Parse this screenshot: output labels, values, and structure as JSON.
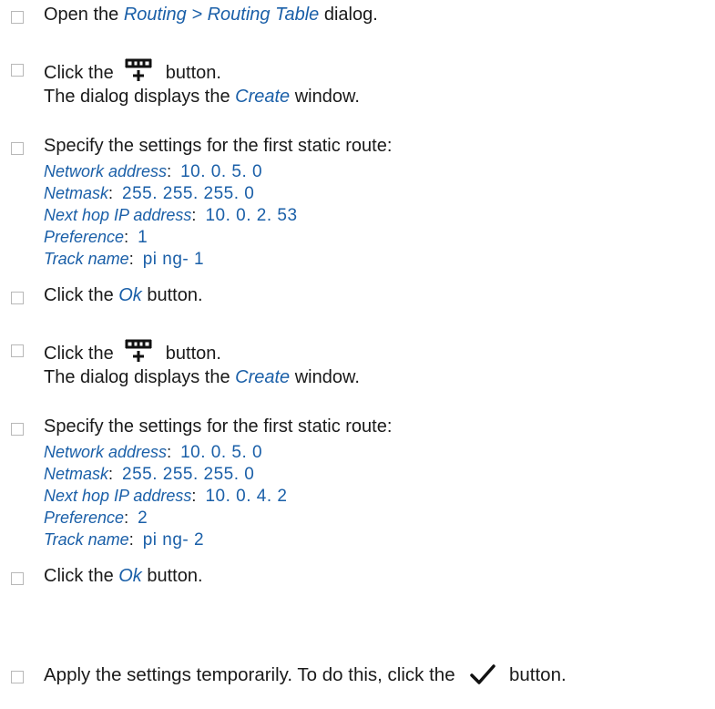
{
  "steps": [
    {
      "pre": "Open the ",
      "ui": "Routing > Routing Table",
      "post": " dialog."
    },
    {
      "pre": "Click the ",
      "icon": "add-table-row-icon",
      "post": " button.",
      "note_pre": "The dialog displays the ",
      "note_ui": "Create",
      "note_post": " window."
    },
    {
      "text": "Specify the settings for the first static route:",
      "fields": [
        {
          "label": "Network address",
          "value": "10. 0. 5. 0"
        },
        {
          "label": "Netmask",
          "value": "255. 255. 255. 0"
        },
        {
          "label": "Next hop IP address",
          "value": "10. 0. 2. 53"
        },
        {
          "label": "Preference",
          "value": "1"
        },
        {
          "label": "Track name",
          "value": "pi ng- 1"
        }
      ]
    },
    {
      "pre": "Click the ",
      "ui": "Ok",
      "post": " button."
    },
    {
      "pre": "Click the ",
      "icon": "add-table-row-icon",
      "post": " button.",
      "note_pre": "The dialog displays the ",
      "note_ui": "Create",
      "note_post": " window."
    },
    {
      "text": "Specify the settings for the first static route:",
      "fields": [
        {
          "label": "Network address",
          "value": "10. 0. 5. 0"
        },
        {
          "label": "Netmask",
          "value": "255. 255. 255. 0"
        },
        {
          "label": "Next hop IP address",
          "value": "10. 0. 4. 2"
        },
        {
          "label": "Preference",
          "value": "2"
        },
        {
          "label": "Track name",
          "value": "pi ng- 2"
        }
      ]
    },
    {
      "pre": "Click the ",
      "ui": "Ok",
      "post": " button."
    },
    {
      "pre": "Apply the settings temporarily. To do this, click the ",
      "icon": "checkmark-icon",
      "post": " button."
    }
  ],
  "colon": ":"
}
